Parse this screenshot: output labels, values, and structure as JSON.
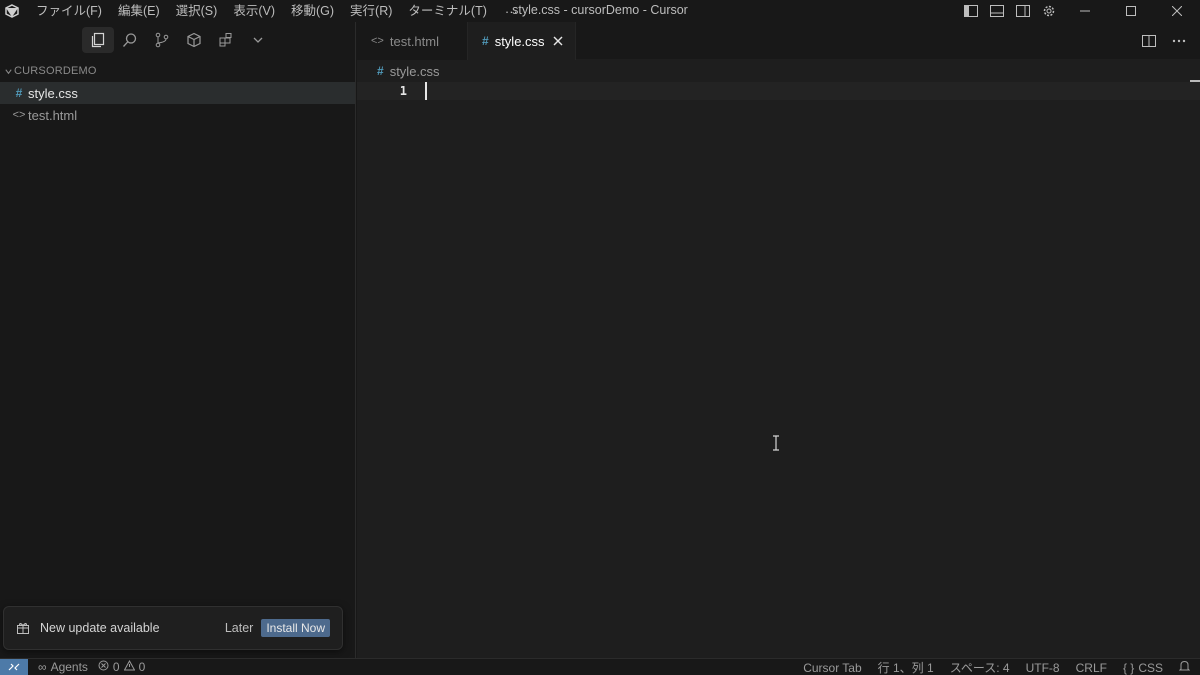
{
  "window": {
    "title": "style.css - cursorDemo - Cursor"
  },
  "menu": {
    "items": [
      "ファイル(F)",
      "編集(E)",
      "選択(S)",
      "表示(V)",
      "移動(G)",
      "実行(R)",
      "ターミナル(T)"
    ],
    "more": "···"
  },
  "sidebar": {
    "section_title": "CURSORDEMO",
    "files": [
      {
        "name": "style.css",
        "icon": "#",
        "selected": true
      },
      {
        "name": "test.html",
        "icon": "<>",
        "selected": false
      }
    ]
  },
  "editor": {
    "tabs": [
      {
        "label": "test.html",
        "icon": "<>",
        "active": false
      },
      {
        "label": "style.css",
        "icon": "#",
        "active": true
      }
    ],
    "breadcrumb": {
      "icon": "#",
      "label": "style.css"
    },
    "line_number": "1"
  },
  "notification": {
    "message": "New update available",
    "later_label": "Later",
    "install_label": "Install Now"
  },
  "statusbar": {
    "agents": "Agents",
    "errors": "0",
    "warnings": "0",
    "cursor_tab": "Cursor Tab",
    "position": "行 1、列 1",
    "spaces": "スペース: 4",
    "encoding": "UTF-8",
    "eol": "CRLF",
    "language": "CSS",
    "language_icon": "{ }"
  },
  "colors": {
    "accent": "#4d7aa8",
    "css_icon": "#519aba",
    "install_button": "#4d6a8d"
  }
}
